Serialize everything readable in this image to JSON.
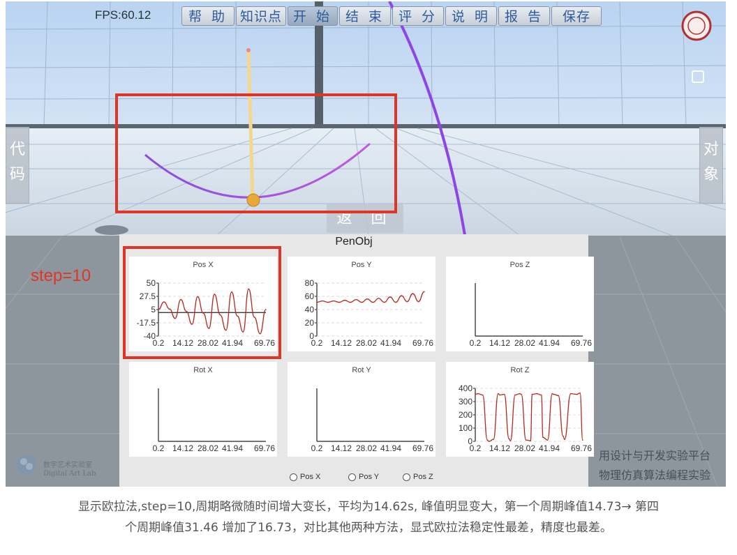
{
  "toolbar": {
    "fps": "FPS:60.12",
    "buttons": [
      "帮 助",
      "知识点",
      "开 始",
      "结 束",
      "评 分",
      "说 明",
      "报 告",
      "保存"
    ]
  },
  "side": {
    "left_label": "代码",
    "right_label": "对象"
  },
  "scene": {
    "return_label": "返 回"
  },
  "annotation": {
    "step_label": "step=10"
  },
  "panel": {
    "title": "PenObj",
    "radios": [
      "Pos X",
      "Pos Y",
      "Pos Z"
    ]
  },
  "chart_data": [
    {
      "type": "line",
      "title": "Pos X",
      "x_ticks": [
        "0.2",
        "14.12",
        "28.02",
        "41.94",
        "69.76"
      ],
      "y_ticks": [
        "50",
        "27.5",
        "5",
        "-17.5",
        "-40"
      ],
      "ylim": [
        -40,
        50
      ],
      "xlim": [
        0.2,
        69.76
      ],
      "series": [
        {
          "color": "#b52a1e",
          "x": [
            0.2,
            3.8,
            7.4,
            11.0,
            14.7,
            18.3,
            21.9,
            25.6,
            29.2,
            32.9,
            36.5,
            40.2,
            43.9,
            47.6,
            51.3,
            55.0,
            58.6,
            62.3,
            66.0,
            69.7
          ],
          "y": [
            5,
            18,
            6,
            -10,
            22,
            2,
            -20,
            27,
            -1,
            -27,
            31,
            -4,
            -30,
            35,
            -6,
            -33,
            40,
            -8,
            -36,
            5
          ]
        }
      ]
    },
    {
      "type": "line",
      "title": "Pos Y",
      "x_ticks": [
        "0.2",
        "14.12",
        "28.02",
        "41.94",
        "69.76"
      ],
      "y_ticks": [
        "80",
        "60",
        "40",
        "20",
        "0"
      ],
      "ylim": [
        0,
        80
      ],
      "xlim": [
        0.2,
        69.76
      ],
      "series": [
        {
          "color": "#b52a1e",
          "x": [
            0.2,
            3.8,
            7.4,
            11.0,
            14.7,
            18.3,
            21.9,
            25.6,
            29.2,
            32.9,
            36.5,
            40.2,
            43.9,
            47.6,
            51.3,
            55.0,
            58.6,
            62.3,
            66.0,
            69.7
          ],
          "y": [
            51,
            53,
            51,
            53,
            51,
            54,
            51,
            55,
            51,
            56,
            51,
            57,
            51,
            59,
            51,
            61,
            52,
            64,
            52,
            67
          ]
        }
      ]
    },
    {
      "type": "line",
      "title": "Pos Z",
      "x_ticks": [
        "0.2",
        "14.12",
        "28.02",
        "41.94",
        "69.76"
      ],
      "y_ticks": [],
      "series": []
    },
    {
      "type": "line",
      "title": "Rot X",
      "x_ticks": [
        "0.2",
        "14.12",
        "28.02",
        "41.94",
        "69.76"
      ],
      "y_ticks": [],
      "series": []
    },
    {
      "type": "line",
      "title": "Rot Y",
      "x_ticks": [
        "0.2",
        "14.12",
        "28.02",
        "41.94",
        "69.76"
      ],
      "y_ticks": [],
      "series": []
    },
    {
      "type": "line",
      "title": "Rot Z",
      "x_ticks": [
        "0.2",
        "14.12",
        "28.02",
        "41.94",
        "69.76"
      ],
      "y_ticks": [
        "400",
        "300",
        "200",
        "100",
        "0"
      ],
      "ylim": [
        0,
        400
      ],
      "xlim": [
        0.2,
        69.76
      ],
      "series": [
        {
          "color": "#b52a1e",
          "x": [
            0.2,
            2,
            5,
            8,
            9,
            12,
            15,
            16,
            19,
            22,
            23,
            26,
            29,
            30,
            33,
            36,
            37,
            40,
            43,
            44,
            47,
            50,
            51,
            54,
            57,
            58,
            62,
            66,
            68,
            69.7
          ],
          "y": [
            355,
            360,
            350,
            10,
            0,
            15,
            360,
            350,
            355,
            20,
            5,
            350,
            360,
            355,
            10,
            5,
            355,
            360,
            350,
            30,
            10,
            360,
            355,
            345,
            40,
            15,
            360,
            355,
            365,
            10
          ]
        }
      ]
    }
  ],
  "watermark": {
    "line1": "用设计与开发实验平台",
    "line2": "物理仿真算法编程实验",
    "lab_cn": "数字艺术实验室",
    "lab_en": "Digital Art Lab"
  },
  "caption": {
    "line1": "显示欧拉法,step=10,周期略微随时间增大变长，平均为14.62s, 峰值明显变大，第一个周期峰值14.73→ 第四",
    "line2": "个周期峰值31.46 增加了16.73，对比其他两种方法，显式欧拉法稳定性最差，精度也最差。"
  }
}
